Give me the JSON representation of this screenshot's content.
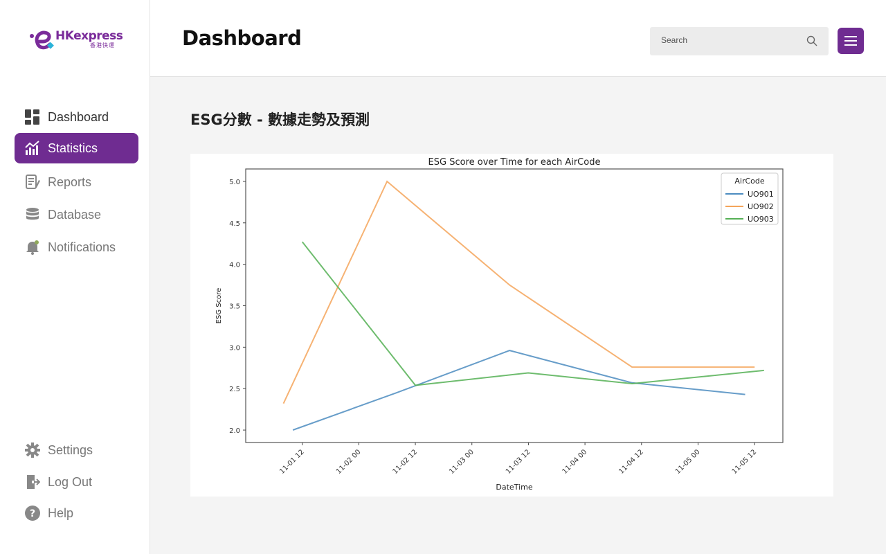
{
  "app": {
    "logo_text": "HKexpress",
    "logo_sub": "香港快運"
  },
  "sidebar": {
    "items": [
      {
        "label": "Dashboard",
        "icon": "dashboard-icon"
      },
      {
        "label": "Statistics",
        "icon": "statistics-icon",
        "active": true
      },
      {
        "label": "Reports",
        "icon": "reports-icon"
      },
      {
        "label": "Database",
        "icon": "database-icon"
      },
      {
        "label": "Notifications",
        "icon": "notifications-icon"
      }
    ],
    "bottom_items": [
      {
        "label": "Settings",
        "icon": "gear-icon"
      },
      {
        "label": "Log Out",
        "icon": "logout-icon"
      },
      {
        "label": "Help",
        "icon": "help-icon"
      }
    ]
  },
  "header": {
    "title": "Dashboard",
    "search_placeholder": "Search"
  },
  "main": {
    "section_title": "ESG分數 - 數據走勢及預測"
  },
  "colors": {
    "accent": "#6f2c91",
    "series_blue": "#4c8cc0",
    "series_orange": "#f4a55a",
    "series_green": "#55b055"
  },
  "chart_data": {
    "type": "line",
    "title": "ESG Score over Time for each AirCode",
    "xlabel": "DateTime",
    "ylabel": "ESG Score",
    "legend_title": "AirCode",
    "legend_position": "top-right",
    "grid": false,
    "ylim": [
      1.85,
      5.15
    ],
    "xlim": [
      "2023-11-01 00:00",
      "2023-11-05 18:00"
    ],
    "x_ticks": [
      "11-01 12",
      "11-02 00",
      "11-02 12",
      "11-03 00",
      "11-03 12",
      "11-04 00",
      "11-04 12",
      "11-05 00",
      "11-05 12"
    ],
    "y_ticks": [
      "2.0",
      "2.5",
      "3.0",
      "3.5",
      "4.0",
      "4.5",
      "5.0"
    ],
    "series": [
      {
        "name": "UO901",
        "color": "#4c8cc0",
        "points": [
          {
            "x": "2023-11-01 10:00",
            "y": 2.0
          },
          {
            "x": "2023-11-02 08:00",
            "y": 2.45
          },
          {
            "x": "2023-11-03 08:00",
            "y": 2.96
          },
          {
            "x": "2023-11-04 10:00",
            "y": 2.57
          },
          {
            "x": "2023-11-05 10:00",
            "y": 2.43
          }
        ]
      },
      {
        "name": "UO902",
        "color": "#f4a55a",
        "points": [
          {
            "x": "2023-11-01 08:00",
            "y": 2.32
          },
          {
            "x": "2023-11-02 06:00",
            "y": 5.0
          },
          {
            "x": "2023-11-03 08:00",
            "y": 3.75
          },
          {
            "x": "2023-11-04 10:00",
            "y": 2.76
          },
          {
            "x": "2023-11-05 12:00",
            "y": 2.76
          }
        ]
      },
      {
        "name": "UO903",
        "color": "#55b055",
        "points": [
          {
            "x": "2023-11-01 12:00",
            "y": 4.27
          },
          {
            "x": "2023-11-02 12:00",
            "y": 2.54
          },
          {
            "x": "2023-11-03 12:00",
            "y": 2.69
          },
          {
            "x": "2023-11-04 10:00",
            "y": 2.56
          },
          {
            "x": "2023-11-05 14:00",
            "y": 2.72
          }
        ]
      }
    ]
  }
}
